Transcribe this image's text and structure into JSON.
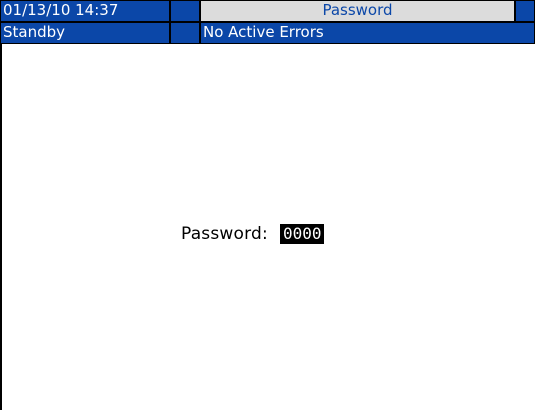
{
  "header": {
    "datetime": "01/13/10 14:37",
    "title": "Password",
    "status": "Standby",
    "errors": "No Active Errors"
  },
  "password_screen": {
    "label": "Password:",
    "value": "0000"
  },
  "colors": {
    "bar_blue": "#0b47a8",
    "title_gray": "#dcdcdc",
    "title_text": "#0b47a8",
    "field_bg": "#000000"
  }
}
